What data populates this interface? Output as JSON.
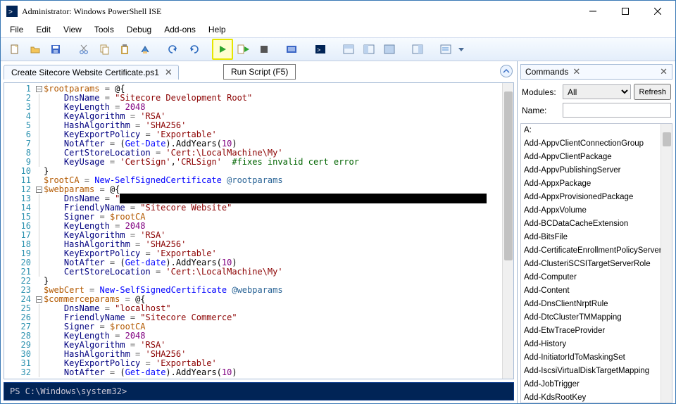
{
  "title": "Administrator: Windows PowerShell ISE",
  "menu": [
    "File",
    "Edit",
    "View",
    "Tools",
    "Debug",
    "Add-ons",
    "Help"
  ],
  "tooltip": "Run Script (F5)",
  "tab": {
    "label": "Create Sitecore Website Certificate.ps1"
  },
  "console_prompt": "PS C:\\Windows\\system32>",
  "commands_panel": {
    "title": "Commands",
    "modules_label": "Modules:",
    "modules_value": "All",
    "refresh": "Refresh",
    "name_label": "Name:",
    "name_value": "",
    "items": [
      "A:",
      "Add-AppvClientConnectionGroup",
      "Add-AppvClientPackage",
      "Add-AppvPublishingServer",
      "Add-AppxPackage",
      "Add-AppxProvisionedPackage",
      "Add-AppxVolume",
      "Add-BCDataCacheExtension",
      "Add-BitsFile",
      "Add-CertificateEnrollmentPolicyServer",
      "Add-ClusteriSCSITargetServerRole",
      "Add-Computer",
      "Add-Content",
      "Add-DnsClientNrptRule",
      "Add-DtcClusterTMMapping",
      "Add-EtwTraceProvider",
      "Add-History",
      "Add-InitiatorIdToMaskingSet",
      "Add-IscsiVirtualDiskTargetMapping",
      "Add-JobTrigger",
      "Add-KdsRootKey"
    ]
  },
  "code_lines": [
    {
      "n": 1,
      "f": "[-]",
      "tokens": [
        {
          "c": "tk-var",
          "t": "$rootparams"
        },
        {
          "c": "tk-op",
          "t": " = "
        },
        {
          "c": "tk-punc",
          "t": "@{"
        }
      ]
    },
    {
      "n": 2,
      "f": "|",
      "tokens": [
        {
          "c": "tk-key",
          "t": "    DnsName"
        },
        {
          "c": "tk-op",
          "t": " = "
        },
        {
          "c": "tk-str",
          "t": "\"Sitecore Development Root\""
        }
      ]
    },
    {
      "n": 3,
      "f": "|",
      "tokens": [
        {
          "c": "tk-key",
          "t": "    KeyLength"
        },
        {
          "c": "tk-op",
          "t": " = "
        },
        {
          "c": "tk-num",
          "t": "2048"
        }
      ]
    },
    {
      "n": 4,
      "f": "|",
      "tokens": [
        {
          "c": "tk-key",
          "t": "    KeyAlgorithm"
        },
        {
          "c": "tk-op",
          "t": " = "
        },
        {
          "c": "tk-str",
          "t": "'RSA'"
        }
      ]
    },
    {
      "n": 5,
      "f": "|",
      "tokens": [
        {
          "c": "tk-key",
          "t": "    HashAlgorithm"
        },
        {
          "c": "tk-op",
          "t": " = "
        },
        {
          "c": "tk-str",
          "t": "'SHA256'"
        }
      ]
    },
    {
      "n": 6,
      "f": "|",
      "tokens": [
        {
          "c": "tk-key",
          "t": "    KeyExportPolicy"
        },
        {
          "c": "tk-op",
          "t": " = "
        },
        {
          "c": "tk-str",
          "t": "'Exportable'"
        }
      ]
    },
    {
      "n": 7,
      "f": "|",
      "tokens": [
        {
          "c": "tk-key",
          "t": "    NotAfter"
        },
        {
          "c": "tk-op",
          "t": " = "
        },
        {
          "c": "tk-punc",
          "t": "("
        },
        {
          "c": "tk-cmd",
          "t": "Get-Date"
        },
        {
          "c": "tk-punc",
          "t": ")."
        },
        {
          "c": "tk-punc",
          "t": "AddYears"
        },
        {
          "c": "tk-punc",
          "t": "("
        },
        {
          "c": "tk-num",
          "t": "10"
        },
        {
          "c": "tk-punc",
          "t": ")"
        }
      ]
    },
    {
      "n": 8,
      "f": "|",
      "tokens": [
        {
          "c": "tk-key",
          "t": "    CertStoreLocation"
        },
        {
          "c": "tk-op",
          "t": " = "
        },
        {
          "c": "tk-str",
          "t": "'Cert:\\LocalMachine\\My'"
        }
      ]
    },
    {
      "n": 9,
      "f": "|",
      "tokens": [
        {
          "c": "tk-key",
          "t": "    KeyUsage"
        },
        {
          "c": "tk-op",
          "t": " = "
        },
        {
          "c": "tk-str",
          "t": "'CertSign'"
        },
        {
          "c": "tk-punc",
          "t": ","
        },
        {
          "c": "tk-str",
          "t": "'CRLSign'"
        },
        {
          "c": "tk-cmt",
          "t": "  #fixes invalid cert error"
        }
      ]
    },
    {
      "n": 10,
      "f": " ",
      "tokens": [
        {
          "c": "tk-punc",
          "t": "}"
        }
      ]
    },
    {
      "n": 11,
      "f": " ",
      "tokens": [
        {
          "c": "tk-var",
          "t": "$rootCA"
        },
        {
          "c": "tk-op",
          "t": " = "
        },
        {
          "c": "tk-cmd",
          "t": "New-SelfSignedCertificate"
        },
        {
          "c": "tk-punc",
          "t": " "
        },
        {
          "c": "tk-spl",
          "t": "@rootparams"
        }
      ]
    },
    {
      "n": 12,
      "f": "[-]",
      "tokens": [
        {
          "c": "tk-var",
          "t": "$webparams"
        },
        {
          "c": "tk-op",
          "t": " = "
        },
        {
          "c": "tk-punc",
          "t": "@{"
        }
      ]
    },
    {
      "n": 13,
      "f": "|",
      "tokens": [
        {
          "c": "tk-key",
          "t": "    DnsName"
        },
        {
          "c": "tk-op",
          "t": " = "
        },
        {
          "c": "tk-str",
          "t": "\""
        },
        {
          "c": "redact",
          "t": "                                                                        "
        }
      ]
    },
    {
      "n": 14,
      "f": "|",
      "tokens": [
        {
          "c": "tk-key",
          "t": "    FriendlyName"
        },
        {
          "c": "tk-op",
          "t": " = "
        },
        {
          "c": "tk-str",
          "t": "\"Sitecore Website\""
        }
      ]
    },
    {
      "n": 15,
      "f": "|",
      "tokens": [
        {
          "c": "tk-key",
          "t": "    Signer"
        },
        {
          "c": "tk-op",
          "t": " = "
        },
        {
          "c": "tk-var",
          "t": "$rootCA"
        }
      ]
    },
    {
      "n": 16,
      "f": "|",
      "tokens": [
        {
          "c": "tk-key",
          "t": "    KeyLength"
        },
        {
          "c": "tk-op",
          "t": " = "
        },
        {
          "c": "tk-num",
          "t": "2048"
        }
      ]
    },
    {
      "n": 17,
      "f": "|",
      "tokens": [
        {
          "c": "tk-key",
          "t": "    KeyAlgorithm"
        },
        {
          "c": "tk-op",
          "t": " = "
        },
        {
          "c": "tk-str",
          "t": "'RSA'"
        }
      ]
    },
    {
      "n": 18,
      "f": "|",
      "tokens": [
        {
          "c": "tk-key",
          "t": "    HashAlgorithm"
        },
        {
          "c": "tk-op",
          "t": " = "
        },
        {
          "c": "tk-str",
          "t": "'SHA256'"
        }
      ]
    },
    {
      "n": 19,
      "f": "|",
      "tokens": [
        {
          "c": "tk-key",
          "t": "    KeyExportPolicy"
        },
        {
          "c": "tk-op",
          "t": " = "
        },
        {
          "c": "tk-str",
          "t": "'Exportable'"
        }
      ]
    },
    {
      "n": 20,
      "f": "|",
      "tokens": [
        {
          "c": "tk-key",
          "t": "    NotAfter"
        },
        {
          "c": "tk-op",
          "t": " = "
        },
        {
          "c": "tk-punc",
          "t": "("
        },
        {
          "c": "tk-cmd",
          "t": "Get-date"
        },
        {
          "c": "tk-punc",
          "t": ")."
        },
        {
          "c": "tk-punc",
          "t": "AddYears"
        },
        {
          "c": "tk-punc",
          "t": "("
        },
        {
          "c": "tk-num",
          "t": "10"
        },
        {
          "c": "tk-punc",
          "t": ")"
        }
      ]
    },
    {
      "n": 21,
      "f": "|",
      "tokens": [
        {
          "c": "tk-key",
          "t": "    CertStoreLocation"
        },
        {
          "c": "tk-op",
          "t": " = "
        },
        {
          "c": "tk-str",
          "t": "'Cert:\\LocalMachine\\My'"
        }
      ]
    },
    {
      "n": 22,
      "f": " ",
      "tokens": [
        {
          "c": "tk-punc",
          "t": "}"
        }
      ]
    },
    {
      "n": 23,
      "f": " ",
      "tokens": [
        {
          "c": "tk-var",
          "t": "$webCert"
        },
        {
          "c": "tk-op",
          "t": " = "
        },
        {
          "c": "tk-cmd",
          "t": "New-SelfSignedCertificate"
        },
        {
          "c": "tk-punc",
          "t": " "
        },
        {
          "c": "tk-spl",
          "t": "@webparams"
        }
      ]
    },
    {
      "n": 24,
      "f": "[-]",
      "tokens": [
        {
          "c": "tk-var",
          "t": "$commerceparams"
        },
        {
          "c": "tk-op",
          "t": " = "
        },
        {
          "c": "tk-punc",
          "t": "@{"
        }
      ]
    },
    {
      "n": 25,
      "f": "|",
      "tokens": [
        {
          "c": "tk-key",
          "t": "    DnsName"
        },
        {
          "c": "tk-op",
          "t": " = "
        },
        {
          "c": "tk-str",
          "t": "\"localhost\""
        }
      ]
    },
    {
      "n": 26,
      "f": "|",
      "tokens": [
        {
          "c": "tk-key",
          "t": "    FriendlyName"
        },
        {
          "c": "tk-op",
          "t": " = "
        },
        {
          "c": "tk-str",
          "t": "\"Sitecore Commerce\""
        }
      ]
    },
    {
      "n": 27,
      "f": "|",
      "tokens": [
        {
          "c": "tk-key",
          "t": "    Signer"
        },
        {
          "c": "tk-op",
          "t": " = "
        },
        {
          "c": "tk-var",
          "t": "$rootCA"
        }
      ]
    },
    {
      "n": 28,
      "f": "|",
      "tokens": [
        {
          "c": "tk-key",
          "t": "    KeyLength"
        },
        {
          "c": "tk-op",
          "t": " = "
        },
        {
          "c": "tk-num",
          "t": "2048"
        }
      ]
    },
    {
      "n": 29,
      "f": "|",
      "tokens": [
        {
          "c": "tk-key",
          "t": "    KeyAlgorithm"
        },
        {
          "c": "tk-op",
          "t": " = "
        },
        {
          "c": "tk-str",
          "t": "'RSA'"
        }
      ]
    },
    {
      "n": 30,
      "f": "|",
      "tokens": [
        {
          "c": "tk-key",
          "t": "    HashAlgorithm"
        },
        {
          "c": "tk-op",
          "t": " = "
        },
        {
          "c": "tk-str",
          "t": "'SHA256'"
        }
      ]
    },
    {
      "n": 31,
      "f": "|",
      "tokens": [
        {
          "c": "tk-key",
          "t": "    KeyExportPolicy"
        },
        {
          "c": "tk-op",
          "t": " = "
        },
        {
          "c": "tk-str",
          "t": "'Exportable'"
        }
      ]
    },
    {
      "n": 32,
      "f": "|",
      "tokens": [
        {
          "c": "tk-key",
          "t": "    NotAfter"
        },
        {
          "c": "tk-op",
          "t": " = "
        },
        {
          "c": "tk-punc",
          "t": "("
        },
        {
          "c": "tk-cmd",
          "t": "Get-date"
        },
        {
          "c": "tk-punc",
          "t": ")."
        },
        {
          "c": "tk-punc",
          "t": "AddYears"
        },
        {
          "c": "tk-punc",
          "t": "("
        },
        {
          "c": "tk-num",
          "t": "10"
        },
        {
          "c": "tk-punc",
          "t": ")"
        }
      ]
    }
  ]
}
